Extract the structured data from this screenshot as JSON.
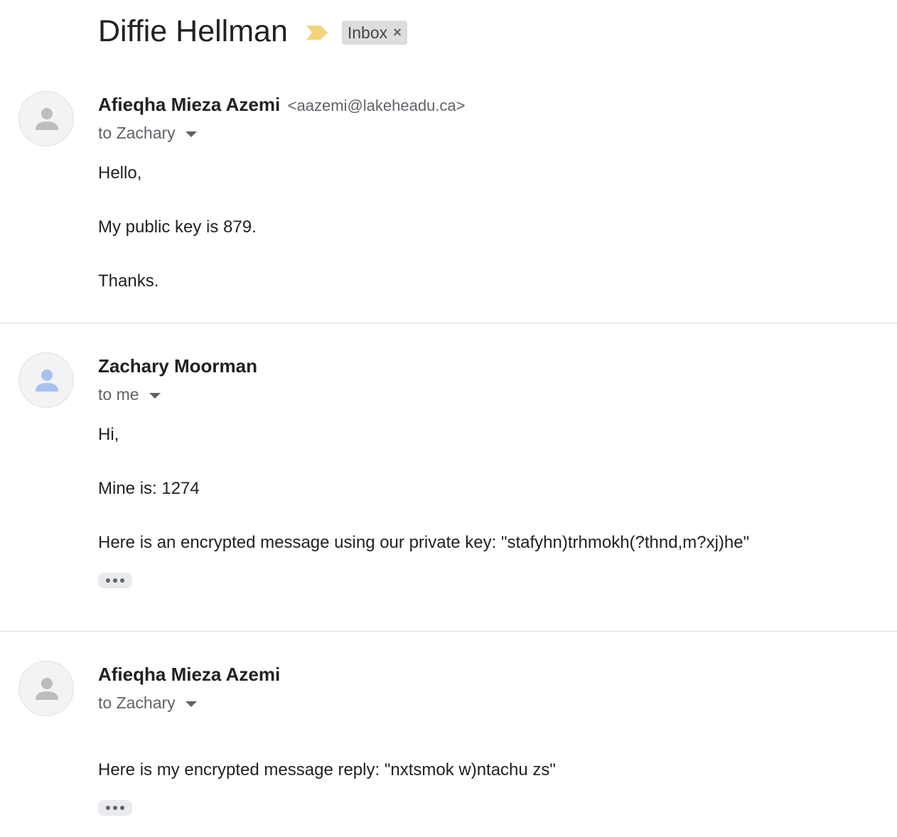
{
  "thread": {
    "subject": "Diffie Hellman",
    "importance_icon": "importance-marker-icon",
    "label": "Inbox",
    "label_remove": "×"
  },
  "messages": [
    {
      "sender_name": "Afieqha Mieza Azemi",
      "sender_email": "<aazemi@lakeheadu.ca>",
      "recipient": "to Zachary",
      "avatar_icon": "person-icon",
      "avatar_color": "#bdbdbd",
      "body": [
        "Hello,",
        "My public key is 879.",
        "Thanks."
      ]
    },
    {
      "sender_name": "Zachary Moorman",
      "recipient": "to me",
      "avatar_icon": "person-icon",
      "avatar_color": "#a8c0f0",
      "body": [
        "Hi,",
        "Mine is: 1274",
        "Here is an encrypted message using our private key: \"stafyhn)trhmokh(?thnd,m?xj)he\""
      ],
      "ellipsis_icon": "more-horiz-icon"
    },
    {
      "sender_name": "Afieqha Mieza Azemi",
      "recipient": "to Zachary",
      "avatar_icon": "person-icon",
      "avatar_color": "#bdbdbd",
      "body": [
        "Here is my encrypted message reply: \"nxtsmok w)ntachu zs\""
      ],
      "ellipsis_icon": "more-horiz-icon"
    }
  ]
}
